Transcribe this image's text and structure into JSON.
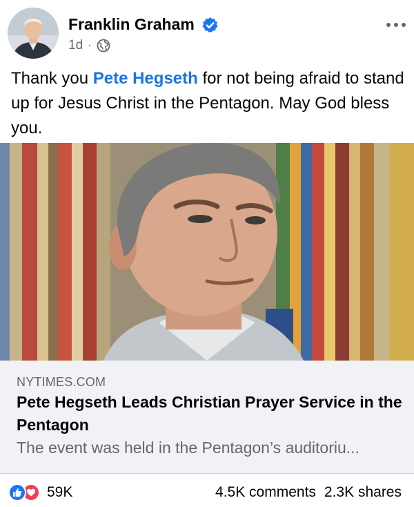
{
  "author": {
    "name": "Franklin Graham",
    "verified": true,
    "time": "1d",
    "separator": "·",
    "audience_icon": "globe-icon"
  },
  "post": {
    "text_before": "Thank you ",
    "mention": "Pete Hegseth",
    "text_after": " for not being afraid to stand up for Jesus Christ in the Pentagon. May God bless you."
  },
  "link_preview": {
    "domain": "NYTIMES.COM",
    "title": "Pete Hegseth Leads Christian Prayer Service in the Pentagon",
    "description": "The event was held in the Pentagon’s auditoriu..."
  },
  "engagement": {
    "reactions_count": "59K",
    "reaction_icons": [
      "like-icon",
      "love-icon"
    ],
    "comments": "4.5K comments",
    "shares": "2.3K shares"
  },
  "colors": {
    "accent": "#1b74e4",
    "secondary_text": "#65676b",
    "like": "#1877f2",
    "love": "#f33e58",
    "link_card_bg": "#f0f2f5"
  }
}
